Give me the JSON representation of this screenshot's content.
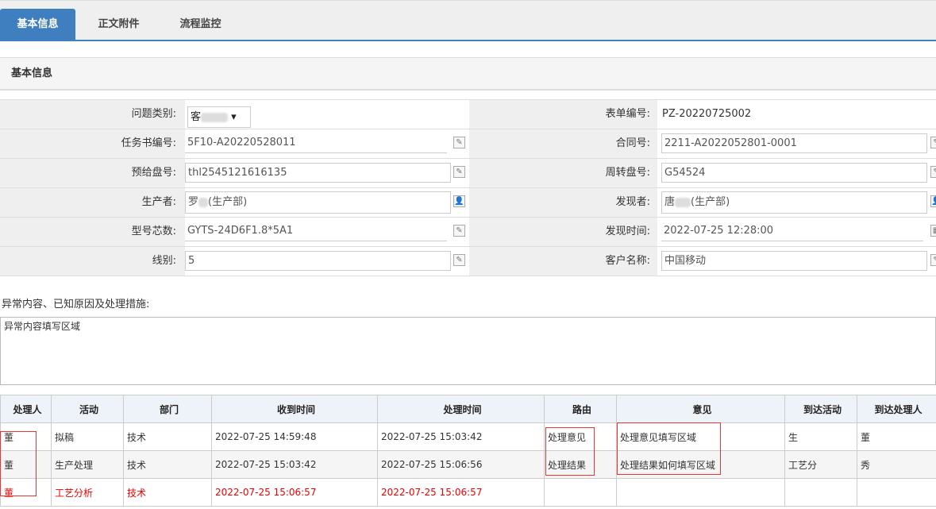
{
  "tabs": [
    {
      "label": "基本信息",
      "active": true
    },
    {
      "label": "正文附件"
    },
    {
      "label": "流程监控"
    }
  ],
  "section_title": "基本信息",
  "form": {
    "issue_type_label": "问题类别:",
    "issue_type_value": "客",
    "task_no_label": "任务书编号:",
    "task_no_value": "5F10-A20220528011",
    "pre_disk_label": "预给盘号:",
    "pre_disk_value": "thl2545121616135",
    "producer_label": "生产者:",
    "producer_value": "罗",
    "producer_dept": "(生产部)",
    "model_label": "型号芯数:",
    "model_value": "GYTS-24D6F1.8*5A1",
    "line_label": "线别:",
    "line_value": "5",
    "form_no_label": "表单编号:",
    "form_no_value": "PZ-20220725002",
    "contract_label": "合同号:",
    "contract_value": "2211-A2022052801-0001",
    "turn_disk_label": "周转盘号:",
    "turn_disk_value": "G54524",
    "finder_label": "发现者:",
    "finder_value": "唐",
    "finder_dept": "(生产部)",
    "find_time_label": "发现时间:",
    "find_time_value": "2022-07-25 12:28:00",
    "customer_label": "客户名称:",
    "customer_value": "中国移动"
  },
  "abnormal": {
    "label": "异常内容、已知原因及处理措施:",
    "value": "异常内容填写区域"
  },
  "table": {
    "headers": [
      "处理人",
      "活动",
      "部门",
      "收到时间",
      "处理时间",
      "路由",
      "意见",
      "到达活动",
      "到达处理人"
    ],
    "rows": [
      [
        "董",
        "拟稿",
        "技术",
        "2022-07-25 14:59:48",
        "2022-07-25 15:03:42",
        "处理意见",
        "处理意见填写区域",
        "生",
        "董"
      ],
      [
        "董",
        "生产处理",
        "技术",
        "2022-07-25 15:03:42",
        "2022-07-25 15:06:56",
        "处理结果",
        "处理结果如何填写区域",
        "工艺分",
        "秀"
      ],
      [
        "董",
        "工艺分析",
        "技术",
        "2022-07-25 15:06:57",
        "2022-07-25 15:06:57",
        "",
        "",
        "",
        ""
      ]
    ]
  }
}
